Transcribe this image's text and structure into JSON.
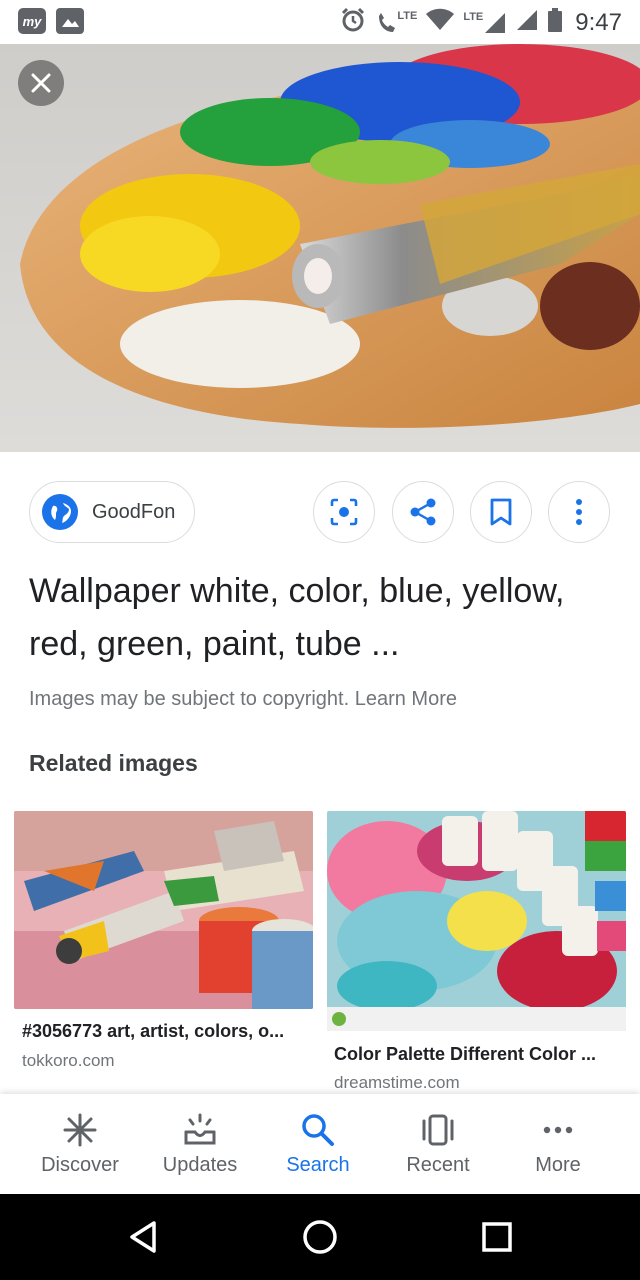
{
  "status_bar": {
    "app_badge": "my",
    "lte1": "LTE",
    "lte2": "LTE",
    "time": "9:47"
  },
  "hero": {
    "image_name": "paint-palette-image",
    "close_icon": "close-icon"
  },
  "source": {
    "name": "GoodFon",
    "icon": "globe-icon"
  },
  "actions": [
    {
      "icon": "lens-icon"
    },
    {
      "icon": "share-icon"
    },
    {
      "icon": "bookmark-icon"
    },
    {
      "icon": "more-vert-icon"
    }
  ],
  "title_line1": "Wallpaper white, color, blue, yellow,",
  "title_line2": "red, green, paint, tube ...",
  "copyright": {
    "text": "Images may be subject to copyright.",
    "link": "Learn More"
  },
  "related": {
    "heading": "Related images",
    "items": [
      {
        "caption": "#3056773 art, artist, colors, o...",
        "domain": "tokkoro.com"
      },
      {
        "caption": "Color Palette Different Color ...",
        "domain": "dreamstime.com"
      }
    ]
  },
  "bottom_nav": [
    {
      "label": "Discover",
      "icon": "discover-icon",
      "active": false
    },
    {
      "label": "Updates",
      "icon": "updates-icon",
      "active": false
    },
    {
      "label": "Search",
      "icon": "search-icon",
      "active": true
    },
    {
      "label": "Recent",
      "icon": "recent-icon",
      "active": false
    },
    {
      "label": "More",
      "icon": "more-horiz-icon",
      "active": false
    }
  ],
  "colors": {
    "accent": "#1a73e8",
    "text_primary": "#202124",
    "text_secondary": "#70757a",
    "border": "#dadce0"
  }
}
